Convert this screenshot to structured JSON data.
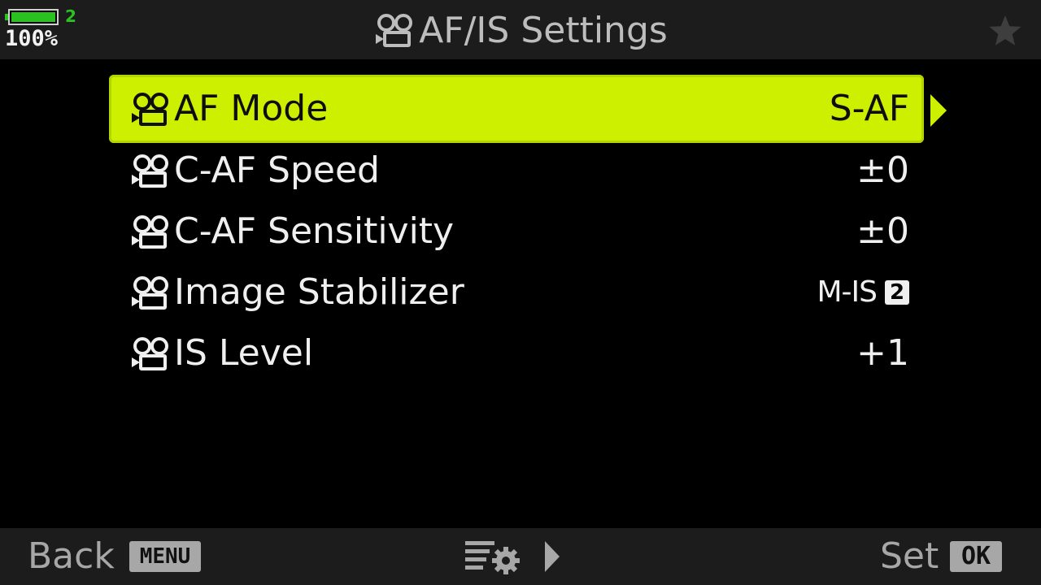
{
  "status": {
    "battery_slot": "2",
    "battery_percent": "100%",
    "battery_level": 1.0,
    "battery_color": "#29c21f"
  },
  "header": {
    "title": "AF/IS Settings",
    "title_icon": "movie-camera-icon",
    "favorite_icon": "star-icon"
  },
  "menu": {
    "accent_color": "#ccf000",
    "items": [
      {
        "label": "AF Mode",
        "value": "S-AF",
        "icon": "movie-camera-icon",
        "selected": true
      },
      {
        "label": "C-AF Speed",
        "value": "±0",
        "icon": "movie-camera-icon",
        "selected": false
      },
      {
        "label": "C-AF Sensitivity",
        "value": "±0",
        "icon": "movie-camera-icon",
        "selected": false
      },
      {
        "label": "Image Stabilizer",
        "value": "M-IS",
        "value_badge": "2",
        "icon": "movie-camera-icon",
        "selected": false
      },
      {
        "label": "IS Level",
        "value": "+1",
        "icon": "movie-camera-icon",
        "selected": false
      }
    ],
    "selected_arrow_icon": "triangle-right-icon"
  },
  "footer": {
    "back_label": "Back",
    "back_key": "MENU",
    "middle_icon": "menu-settings-icon",
    "middle_arrow_icon": "triangle-right-icon",
    "set_label": "Set",
    "set_key": "OK"
  }
}
